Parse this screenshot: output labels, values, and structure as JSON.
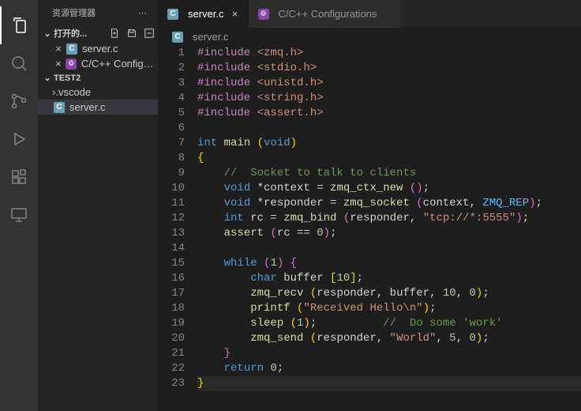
{
  "activitybar": {
    "items": [
      {
        "name": "explorer",
        "active": true
      },
      {
        "name": "search"
      },
      {
        "name": "source-control"
      },
      {
        "name": "run-debug"
      },
      {
        "name": "extensions"
      },
      {
        "name": "remote"
      }
    ]
  },
  "sidebar": {
    "title": "资源管理器",
    "open_editors_label": "打开的...",
    "open_editors": [
      {
        "label": "server.c",
        "icon": "c",
        "active": true
      },
      {
        "label": "C/C++ Configur...",
        "icon": "cfg"
      }
    ],
    "workspace_label": "TEST2",
    "workspace_items": [
      {
        "label": ".vscode",
        "type": "folder"
      },
      {
        "label": "server.c",
        "type": "file",
        "icon": "c",
        "selected": true
      }
    ]
  },
  "tabs": [
    {
      "label": "server.c",
      "icon": "c",
      "active": true,
      "closable": true
    },
    {
      "label": "C/C++ Configurations",
      "icon": "cfg",
      "active": false
    }
  ],
  "breadcrumb": {
    "icon": "c",
    "label": "server.c"
  },
  "code": {
    "lines": [
      {
        "n": 1,
        "tokens": [
          [
            "tok-inc",
            "#include"
          ],
          [
            "",
            " "
          ],
          [
            "tok-str",
            "<zmq.h>"
          ]
        ]
      },
      {
        "n": 2,
        "tokens": [
          [
            "tok-inc",
            "#include"
          ],
          [
            "",
            " "
          ],
          [
            "tok-str",
            "<stdio.h>"
          ]
        ]
      },
      {
        "n": 3,
        "tokens": [
          [
            "tok-inc",
            "#include"
          ],
          [
            "",
            " "
          ],
          [
            "tok-str",
            "<unistd.h>"
          ]
        ]
      },
      {
        "n": 4,
        "tokens": [
          [
            "tok-inc",
            "#include"
          ],
          [
            "",
            " "
          ],
          [
            "tok-str",
            "<string.h>"
          ]
        ]
      },
      {
        "n": 5,
        "tokens": [
          [
            "tok-inc",
            "#include"
          ],
          [
            "",
            " "
          ],
          [
            "tok-str",
            "<assert.h>"
          ]
        ]
      },
      {
        "n": 6,
        "tokens": []
      },
      {
        "n": 7,
        "tokens": [
          [
            "tok-kw",
            "int"
          ],
          [
            "",
            " "
          ],
          [
            "tok-fn",
            "main"
          ],
          [
            "",
            " "
          ],
          [
            "tok-br",
            "("
          ],
          [
            "tok-kw",
            "void"
          ],
          [
            "tok-br",
            ")"
          ]
        ]
      },
      {
        "n": 8,
        "tokens": [
          [
            "tok-br",
            "{"
          ]
        ]
      },
      {
        "n": 9,
        "tokens": [
          [
            "",
            "    "
          ],
          [
            "tok-cm",
            "//  Socket to talk to clients"
          ]
        ]
      },
      {
        "n": 10,
        "tokens": [
          [
            "",
            "    "
          ],
          [
            "tok-kw",
            "void"
          ],
          [
            "",
            " *context = "
          ],
          [
            "tok-fn",
            "zmq_ctx_new"
          ],
          [
            "",
            " "
          ],
          [
            "tok-br2",
            "("
          ],
          [
            "tok-br2",
            ")"
          ],
          [
            "",
            ";"
          ]
        ]
      },
      {
        "n": 11,
        "tokens": [
          [
            "",
            "    "
          ],
          [
            "tok-kw",
            "void"
          ],
          [
            "",
            " *responder = "
          ],
          [
            "tok-fn",
            "zmq_socket"
          ],
          [
            "",
            " "
          ],
          [
            "tok-br2",
            "("
          ],
          [
            "",
            "context, "
          ],
          [
            "tok-const",
            "ZMQ_REP"
          ],
          [
            "tok-br2",
            ")"
          ],
          [
            "",
            ";"
          ]
        ]
      },
      {
        "n": 12,
        "tokens": [
          [
            "",
            "    "
          ],
          [
            "tok-kw",
            "int"
          ],
          [
            "",
            " rc = "
          ],
          [
            "tok-fn",
            "zmq_bind"
          ],
          [
            "",
            " "
          ],
          [
            "tok-br2",
            "("
          ],
          [
            "",
            "responder, "
          ],
          [
            "tok-str",
            "\"tcp://*:5555\""
          ],
          [
            "tok-br2",
            ")"
          ],
          [
            "",
            ";"
          ]
        ]
      },
      {
        "n": 13,
        "tokens": [
          [
            "",
            "    "
          ],
          [
            "tok-fn",
            "assert"
          ],
          [
            "",
            " "
          ],
          [
            "tok-br2",
            "("
          ],
          [
            "",
            "rc == "
          ],
          [
            "tok-num",
            "0"
          ],
          [
            "tok-br2",
            ")"
          ],
          [
            "",
            ";"
          ]
        ]
      },
      {
        "n": 14,
        "tokens": []
      },
      {
        "n": 15,
        "tokens": [
          [
            "",
            "    "
          ],
          [
            "tok-kw",
            "while"
          ],
          [
            "",
            " "
          ],
          [
            "tok-br2",
            "("
          ],
          [
            "tok-num",
            "1"
          ],
          [
            "tok-br2",
            ")"
          ],
          [
            "",
            " "
          ],
          [
            "tok-br2",
            "{"
          ]
        ]
      },
      {
        "n": 16,
        "tokens": [
          [
            "",
            "        "
          ],
          [
            "tok-kw",
            "char"
          ],
          [
            "",
            " buffer "
          ],
          [
            "tok-br",
            "["
          ],
          [
            "tok-num",
            "10"
          ],
          [
            "tok-br",
            "]"
          ],
          [
            "",
            ";"
          ]
        ]
      },
      {
        "n": 17,
        "tokens": [
          [
            "",
            "        "
          ],
          [
            "tok-fn",
            "zmq_recv"
          ],
          [
            "",
            " "
          ],
          [
            "tok-br",
            "("
          ],
          [
            "",
            "responder, buffer, "
          ],
          [
            "tok-num",
            "10"
          ],
          [
            "",
            ", "
          ],
          [
            "tok-num",
            "0"
          ],
          [
            "tok-br",
            ")"
          ],
          [
            "",
            ";"
          ]
        ]
      },
      {
        "n": 18,
        "tokens": [
          [
            "",
            "        "
          ],
          [
            "tok-fn",
            "printf"
          ],
          [
            "",
            " "
          ],
          [
            "tok-br",
            "("
          ],
          [
            "tok-str",
            "\"Received Hello\\n\""
          ],
          [
            "tok-br",
            ")"
          ],
          [
            "",
            ";"
          ]
        ]
      },
      {
        "n": 19,
        "tokens": [
          [
            "",
            "        "
          ],
          [
            "tok-fn",
            "sleep"
          ],
          [
            "",
            " "
          ],
          [
            "tok-br",
            "("
          ],
          [
            "tok-num",
            "1"
          ],
          [
            "tok-br",
            ")"
          ],
          [
            "",
            ";          "
          ],
          [
            "tok-cm",
            "//  Do some 'work'"
          ]
        ]
      },
      {
        "n": 20,
        "tokens": [
          [
            "",
            "        "
          ],
          [
            "tok-fn",
            "zmq_send"
          ],
          [
            "",
            " "
          ],
          [
            "tok-br",
            "("
          ],
          [
            "",
            "responder, "
          ],
          [
            "tok-str",
            "\"World\""
          ],
          [
            "",
            ", "
          ],
          [
            "tok-num",
            "5"
          ],
          [
            "",
            ", "
          ],
          [
            "tok-num",
            "0"
          ],
          [
            "tok-br",
            ")"
          ],
          [
            "",
            ";"
          ]
        ]
      },
      {
        "n": 21,
        "tokens": [
          [
            "",
            "    "
          ],
          [
            "tok-br2",
            "}"
          ]
        ]
      },
      {
        "n": 22,
        "tokens": [
          [
            "",
            "    "
          ],
          [
            "tok-kw",
            "return"
          ],
          [
            "",
            " "
          ],
          [
            "tok-num",
            "0"
          ],
          [
            "",
            ";"
          ]
        ]
      },
      {
        "n": 23,
        "tokens": [
          [
            "tok-br",
            "}"
          ]
        ],
        "current": true
      }
    ]
  }
}
